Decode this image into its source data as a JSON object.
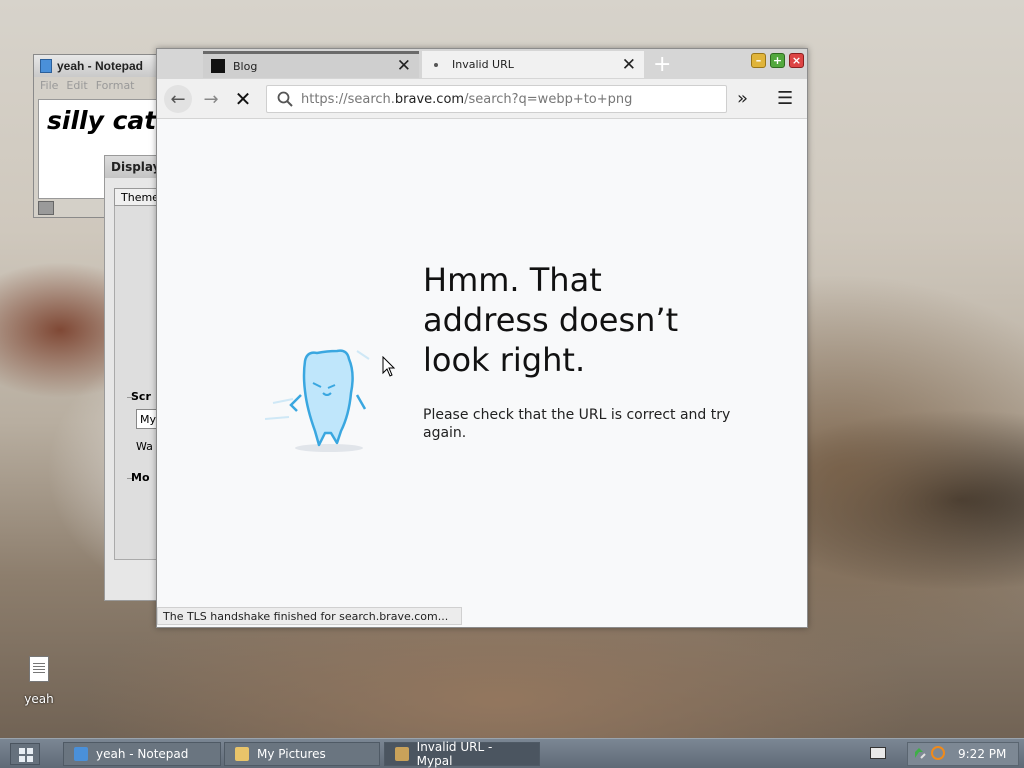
{
  "desktop": {
    "icons": [
      {
        "label": "yeah",
        "icon": "text-file-icon"
      }
    ]
  },
  "notepad": {
    "title": "yeah - Notepad",
    "menu": [
      "File",
      "Edit",
      "Format"
    ],
    "content": "silly cat"
  },
  "display_dialog": {
    "title": "Display",
    "tab": "Theme",
    "section_screen": "Scr",
    "field": "My",
    "label_wa": "Wa",
    "section_mo": "Mo"
  },
  "browser": {
    "tabs": [
      {
        "label": "Blog",
        "active": false
      },
      {
        "label": "Invalid URL",
        "active": true
      }
    ],
    "url": {
      "prefix": "https://search.",
      "host": "brave.com",
      "rest": "/search?q=webp+to+png"
    },
    "error_title": "Hmm. That address doesn’t look right.",
    "error_message": "Please check that the URL is correct and try again.",
    "status": "The TLS handshake finished for search.brave.com..."
  },
  "taskbar": {
    "tasks": [
      {
        "label": "yeah - Notepad"
      },
      {
        "label": "My Pictures"
      },
      {
        "label": "Invalid URL - Mypal"
      }
    ],
    "clock": "9:22 PM"
  }
}
